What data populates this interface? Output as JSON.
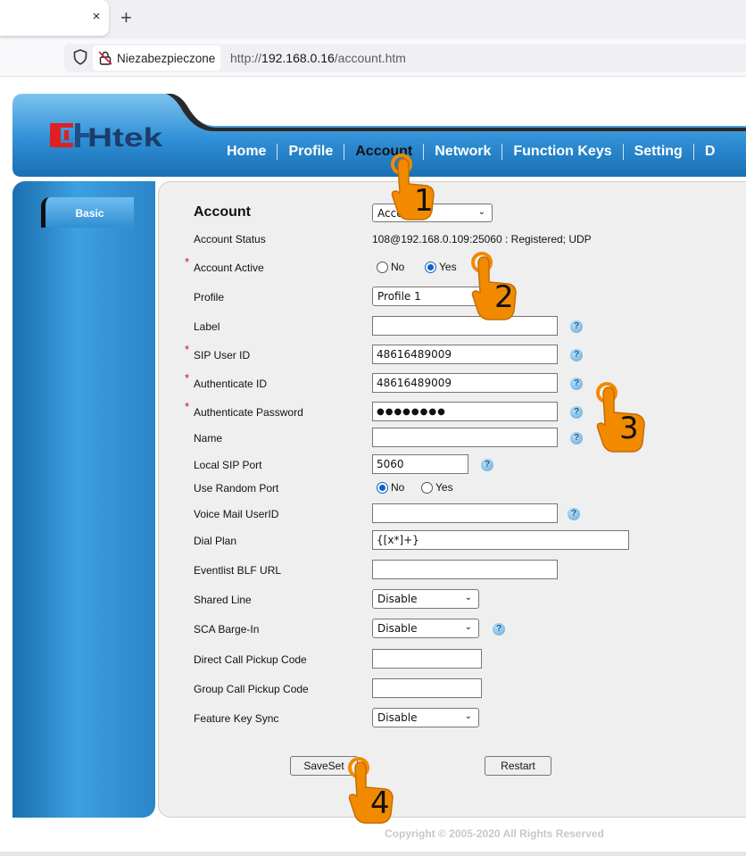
{
  "browser": {
    "tab_close": "×",
    "new_tab": "+",
    "security_label": "Niezabezpieczone",
    "url_prefix": "http://",
    "url_host": "192.168.0.16",
    "url_path": "/account.htm"
  },
  "header": {
    "logo_text": "Htek",
    "nav": [
      "Home",
      "Profile",
      "Account",
      "Network",
      "Function Keys",
      "Setting",
      "D"
    ],
    "active_nav": "Account"
  },
  "sidebar": {
    "basic_label": "Basic"
  },
  "form": {
    "title": "Account",
    "account_select": "Account 1",
    "status_label": "Account Status",
    "status_value": "108@192.168.0.109:25060 : Registered; UDP",
    "active_label": "Account Active",
    "active_options": [
      "No",
      "Yes"
    ],
    "active_selected": "Yes",
    "profile_label": "Profile",
    "profile_value": "Profile 1",
    "label_label": "Label",
    "label_value": "",
    "sip_user_label": "SIP User ID",
    "sip_user_value": "48616489009",
    "auth_id_label": "Authenticate ID",
    "auth_id_value": "48616489009",
    "auth_pw_label": "Authenticate Password",
    "auth_pw_value": "●●●●●●●●",
    "name_label": "Name",
    "name_value": "",
    "local_port_label": "Local SIP Port",
    "local_port_value": "5060",
    "random_port_label": "Use Random Port",
    "random_port_options": [
      "No",
      "Yes"
    ],
    "random_port_selected": "No",
    "voicemail_label": "Voice Mail UserID",
    "voicemail_value": "",
    "dial_plan_label": "Dial Plan",
    "dial_plan_value": "{[x*]+}",
    "blf_label": "Eventlist BLF URL",
    "blf_value": "",
    "shared_line_label": "Shared Line",
    "shared_line_value": "Disable",
    "sca_label": "SCA Barge-In",
    "sca_value": "Disable",
    "direct_pickup_label": "Direct Call Pickup Code",
    "direct_pickup_value": "",
    "group_pickup_label": "Group Call Pickup Code",
    "group_pickup_value": "",
    "feature_sync_label": "Feature Key Sync",
    "feature_sync_value": "Disable",
    "save_label": "SaveSet",
    "restart_label": "Restart",
    "required_mark": "*",
    "help_mark": "?"
  },
  "footer": {
    "copyright": "Copyright © 2005-2020 All Rights Reserved"
  },
  "annotations": {
    "steps": [
      "1",
      "2",
      "3",
      "4"
    ],
    "hand_color": "#f28a00"
  }
}
